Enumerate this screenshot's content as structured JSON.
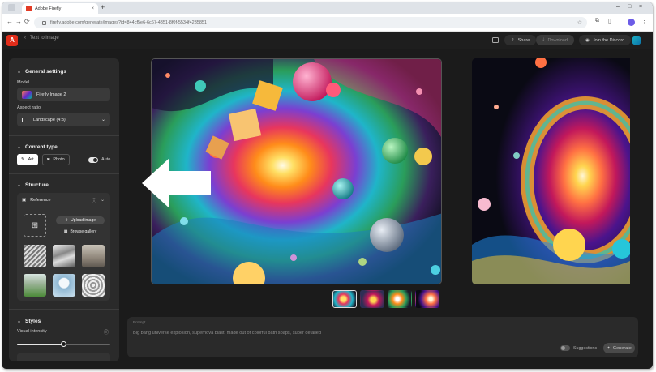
{
  "browser": {
    "tab_title": "Adobe Firefly",
    "tab_close": "×",
    "new_tab": "+",
    "url": "firefly.adobe.com/generate/images?id=844cf5e6-6c67-4351-8f0f-5534f4235851",
    "nav_back": "←",
    "nav_forward": "→",
    "reload": "⟳",
    "bookmark_star": "☆",
    "window_controls": [
      "–",
      "□",
      "×"
    ]
  },
  "app_header": {
    "back_arrow": "‹",
    "back_label": "Text to image",
    "share_label": "Share",
    "download_label": "Download",
    "discord_label": "Join the Discord"
  },
  "sidebar": {
    "general_settings": {
      "title": "General settings",
      "model_label": "Model",
      "model_value": "Firefly Image 2",
      "aspect_label": "Aspect ratio",
      "aspect_value": "Landscape (4:3)"
    },
    "content_type": {
      "title": "Content type",
      "art_label": "Art",
      "photo_label": "Photo",
      "auto_label": "Auto",
      "selected": "Art",
      "auto_enabled": true
    },
    "structure": {
      "title": "Structure",
      "reference_label": "Reference",
      "upload_label": "Upload image",
      "browse_label": "Browse gallery"
    },
    "styles": {
      "title": "Styles",
      "intensity_label": "Visual intensity",
      "intensity_value": 0.5
    }
  },
  "thumbnails": {
    "count": 4,
    "selected_index": 0
  },
  "prompt": {
    "tag": "Prompt",
    "text": "Big bang universe explosion, supernova blast, made out of colorful bath soaps, super detailed",
    "suggestions_label": "Suggestions",
    "generate_label": "Generate"
  },
  "colors": {
    "accent_adobe": "#e22d1a",
    "panel_bg": "#2a2a2a",
    "app_bg": "#1b1b1b"
  }
}
